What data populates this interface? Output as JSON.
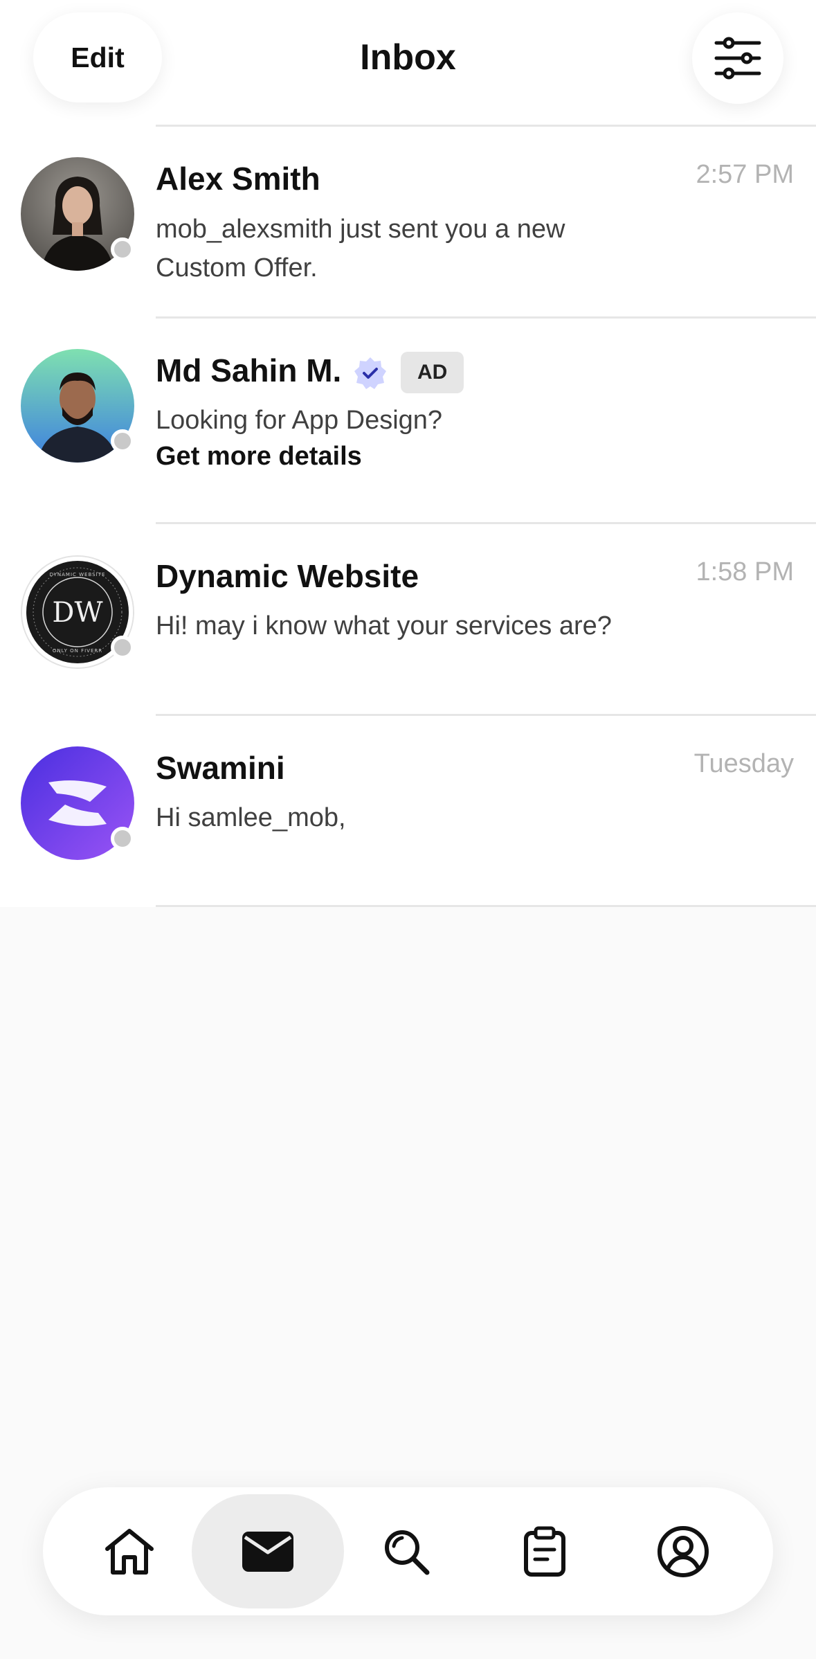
{
  "header": {
    "edit_label": "Edit",
    "title": "Inbox",
    "filter_icon": "sliders-icon"
  },
  "conversations": [
    {
      "name": "Alex Smith",
      "time": "2:57 PM",
      "message": "mob_alexsmith just sent you a new Custom Offer.",
      "online": false,
      "avatar": "photo"
    },
    {
      "name": "Md Sahin M.",
      "verified": true,
      "badge": "AD",
      "message": "Looking for App Design?",
      "cta": "Get more details",
      "online": false,
      "avatar": "photo"
    },
    {
      "name": "Dynamic Website",
      "time": "1:58 PM",
      "message": "Hi! may i know what your services are?",
      "online": false,
      "avatar_logo": {
        "initials": "DW",
        "ring_text": "DYNAMIC WEBSITE",
        "ring_text_bottom": "ONLY ON FIVERR"
      }
    },
    {
      "name": "Swamini",
      "time": "Tuesday",
      "message": "Hi samlee_mob,",
      "online": false,
      "avatar": "logo"
    }
  ],
  "bottom_nav": {
    "items": [
      {
        "icon": "home-icon",
        "active": false
      },
      {
        "icon": "mail-icon",
        "active": true
      },
      {
        "icon": "search-icon",
        "active": false
      },
      {
        "icon": "clipboard-icon",
        "active": false
      },
      {
        "icon": "profile-icon",
        "active": false
      }
    ]
  },
  "colors": {
    "background": "#fafafa",
    "status_offline": "#c9c9c9",
    "verified_badge": "#cfd3ff",
    "swamini_gradient": [
      "#4a2fe0",
      "#9a54f5"
    ]
  }
}
